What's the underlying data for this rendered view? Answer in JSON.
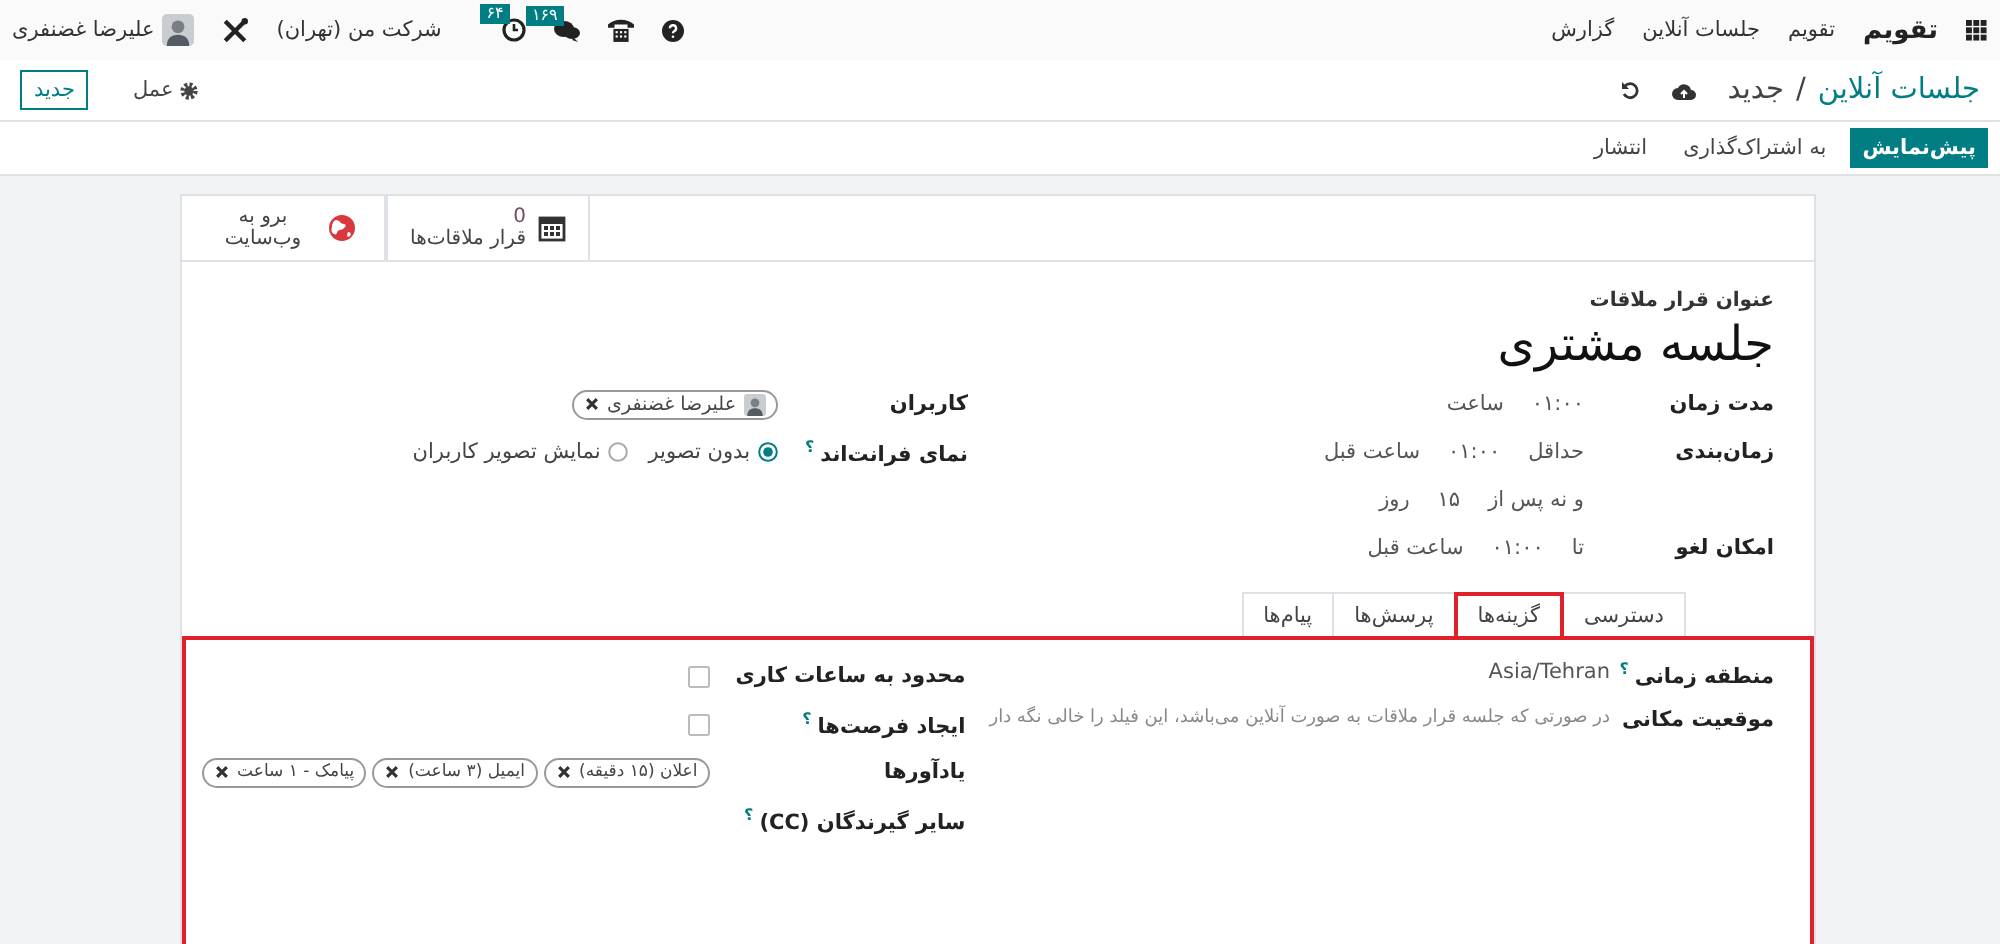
{
  "navbar": {
    "app_name": "تقویم",
    "menu": [
      "تقویم",
      "جلسات آنلاین",
      "گزارش"
    ],
    "messages_badge": "۱۶۹",
    "activities_badge": "۶۴",
    "company": "شرکت من (تهران)",
    "user": "علیرضا غضنفری"
  },
  "breadcrumb": {
    "parent": "جلسات آنلاین",
    "separator": "/",
    "current": "جدید"
  },
  "control": {
    "action_menu": "عمل",
    "new_button": "جدید"
  },
  "header_buttons": [
    {
      "label": "پیش‌نمایش",
      "kind": "primary"
    },
    {
      "label": "به اشتراک‌گذاری",
      "kind": "secondary"
    },
    {
      "label": "انتشار",
      "kind": "secondary"
    }
  ],
  "stat_buttons": [
    {
      "kind": "appointments",
      "value": "0",
      "label": "قرار ملاقات‌ها"
    },
    {
      "kind": "website",
      "label": "برو به وب‌سایت"
    }
  ],
  "form": {
    "title_label": "عنوان قرار ملاقات",
    "title": "جلسه مشتری",
    "right_fields": [
      {
        "label": "مدت زمان",
        "parts": [
          "۰۱:۰۰",
          "ساعت"
        ]
      },
      {
        "label": "زمان‌بندی",
        "parts": [
          "حداقل",
          "۰۱:۰۰",
          "ساعت قبل"
        ]
      },
      {
        "parts": [
          "و نه پس از",
          "۱۵",
          "روز"
        ]
      },
      {
        "label": "امکان لغو",
        "parts": [
          "تا",
          "۰۱:۰۰",
          "ساعت قبل"
        ]
      }
    ],
    "left_fields": [
      {
        "kind": "users",
        "label": "کاربران",
        "tags": [
          "علیرضا غضنفری"
        ]
      },
      {
        "kind": "radio",
        "label": "نمای فرانت‌اند",
        "help": "؟",
        "options": [
          {
            "label": "بدون تصویر",
            "selected": true
          },
          {
            "label": "نمایش تصویر کاربران",
            "selected": false
          }
        ]
      }
    ]
  },
  "tabs": [
    {
      "label": "دسترسی",
      "selected": false
    },
    {
      "label": "گزینه‌ها",
      "selected": true
    },
    {
      "label": "پرسش‌ها",
      "selected": false
    },
    {
      "label": "پیام‌ها",
      "selected": false
    }
  ],
  "options_tab": {
    "right_fields": [
      {
        "kind": "text",
        "label": "منطقه زمانی",
        "help": "؟",
        "value": "Asia/Tehran"
      },
      {
        "kind": "textarea",
        "label": "موقعیت مکانی",
        "placeholder": "در صورتی که جلسه قرار ملاقات به صورت آنلاین می‌باشد، این فیلد را خالی نگه دار"
      }
    ],
    "left_fields": [
      {
        "kind": "checkbox",
        "label": "محدود به ساعات کاری",
        "checked": false
      },
      {
        "kind": "checkbox",
        "label": "ایجاد فرصت‌ها",
        "help": "؟",
        "checked": false
      },
      {
        "kind": "tags",
        "label": "یادآورها",
        "tags": [
          "اعلان (۱۵ دقیقه)",
          "ایمیل (۳ ساعت)",
          "پیامک - ۱ ساعت"
        ]
      },
      {
        "kind": "empty",
        "label": "سایر گیرندگان (CC)",
        "help": "؟"
      }
    ]
  }
}
